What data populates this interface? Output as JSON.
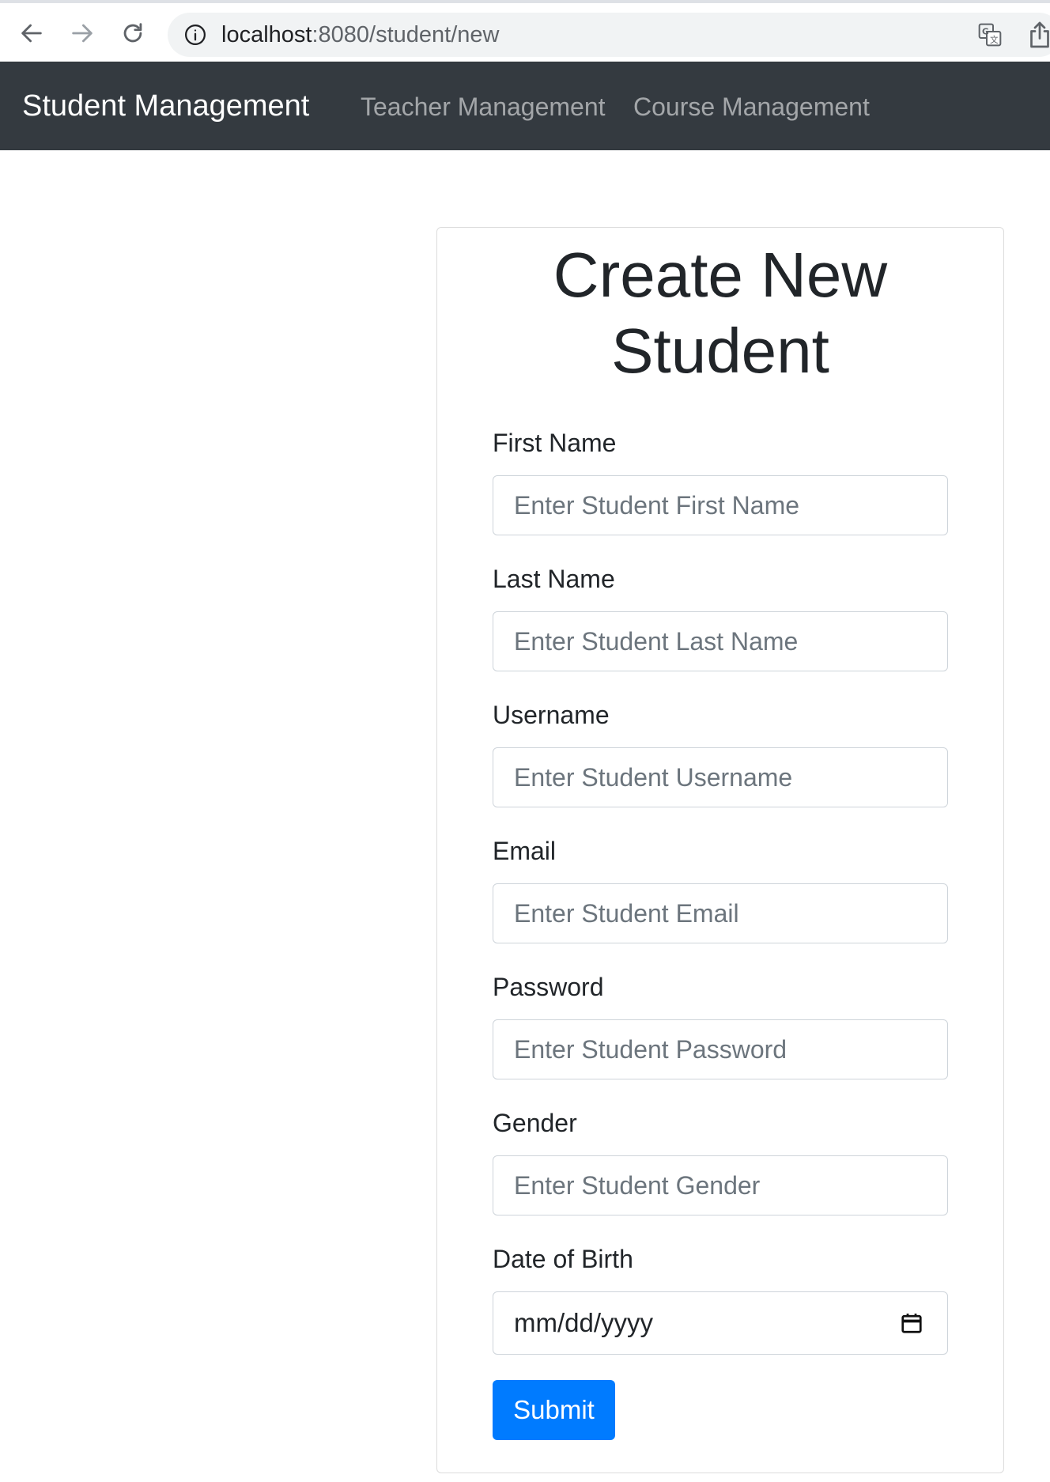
{
  "browser": {
    "url_host": "localhost",
    "url_rest": ":8080/student/new"
  },
  "navbar": {
    "brand": "Student Management",
    "links": [
      {
        "label": "Teacher Management"
      },
      {
        "label": "Course Management"
      }
    ]
  },
  "form": {
    "title_line1": "Create New",
    "title_line2": "Student",
    "fields": [
      {
        "label": "First Name",
        "placeholder": "Enter Student First Name"
      },
      {
        "label": "Last Name",
        "placeholder": "Enter Student Last Name"
      },
      {
        "label": "Username",
        "placeholder": "Enter Student Username"
      },
      {
        "label": "Email",
        "placeholder": "Enter Student Email"
      },
      {
        "label": "Password",
        "placeholder": "Enter Student Password"
      },
      {
        "label": "Gender",
        "placeholder": "Enter Student Gender"
      }
    ],
    "dob": {
      "label": "Date of Birth",
      "value": "mm/dd/yyyy"
    },
    "submit_label": "Submit"
  },
  "colors": {
    "navbar_bg": "#343a40",
    "primary_button": "#007bff"
  },
  "icons": [
    "back-arrow-icon",
    "forward-arrow-icon",
    "reload-icon",
    "info-icon",
    "translate-icon",
    "share-icon",
    "calendar-icon"
  ]
}
